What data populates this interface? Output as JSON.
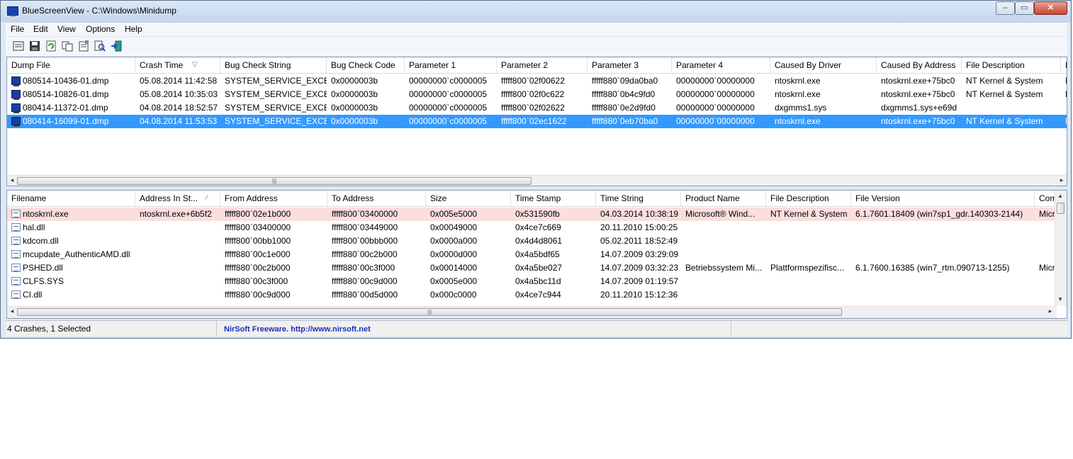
{
  "window": {
    "title": "BlueScreenView  -  C:\\Windows\\Minidump",
    "minimize": "–",
    "maximize": "▭",
    "close": "✕"
  },
  "menu": [
    "File",
    "Edit",
    "View",
    "Options",
    "Help"
  ],
  "toolbar": [
    "html-report-icon",
    "save-icon",
    "refresh-icon",
    "copy-icon",
    "properties-icon",
    "find-icon",
    "exit-icon"
  ],
  "top_table": {
    "headers": [
      "Dump File",
      "Crash Time",
      "Bug Check String",
      "Bug Check Code",
      "Parameter 1",
      "Parameter 2",
      "Parameter 3",
      "Parameter 4",
      "Caused By Driver",
      "Caused By Address",
      "File Description",
      "P"
    ],
    "sort_indicator": "▽",
    "rows": [
      [
        "080514-10436-01.dmp",
        "05.08.2014 11:42:58",
        "SYSTEM_SERVICE_EXCE...",
        "0x0000003b",
        "00000000`c0000005",
        "fffff800`02f00622",
        "fffff880`09da0ba0",
        "00000000`00000000",
        "ntoskrnl.exe",
        "ntoskrnl.exe+75bc0",
        "NT Kernel & System",
        "N"
      ],
      [
        "080514-10826-01.dmp",
        "05.08.2014 10:35:03",
        "SYSTEM_SERVICE_EXCE...",
        "0x0000003b",
        "00000000`c0000005",
        "fffff800`02f0c622",
        "fffff880`0b4c9fd0",
        "00000000`00000000",
        "ntoskrnl.exe",
        "ntoskrnl.exe+75bc0",
        "NT Kernel & System",
        "N"
      ],
      [
        "080414-11372-01.dmp",
        "04.08.2014 18:52:57",
        "SYSTEM_SERVICE_EXCE...",
        "0x0000003b",
        "00000000`c0000005",
        "fffff800`02f02622",
        "fffff880`0e2d9fd0",
        "00000000`00000000",
        "dxgmms1.sys",
        "dxgmms1.sys+e69d",
        "",
        ""
      ],
      [
        "080414-16099-01.dmp",
        "04.08.2014 11:53:53",
        "SYSTEM_SERVICE_EXCE...",
        "0x0000003b",
        "00000000`c0000005",
        "fffff800`02ec1622",
        "fffff880`0eb70ba0",
        "00000000`00000000",
        "ntoskrnl.exe",
        "ntoskrnl.exe+75bc0",
        "NT Kernel & System",
        "N"
      ]
    ],
    "selected_index": 3
  },
  "bottom_table": {
    "headers": [
      "Filename",
      "Address In St...",
      "From Address",
      "To Address",
      "Size",
      "Time Stamp",
      "Time String",
      "Product Name",
      "File Description",
      "File Version",
      "Com"
    ],
    "sort_indicator": "∕",
    "rows": [
      [
        "ntoskrnl.exe",
        "ntoskrnl.exe+6b5f2",
        "fffff800`02e1b000",
        "fffff800`03400000",
        "0x005e5000",
        "0x531590fb",
        "04.03.2014 10:38:19",
        "Microsoft® Wind...",
        "NT Kernel & System",
        "6.1.7601.18409 (win7sp1_gdr.140303-2144)",
        "Micr"
      ],
      [
        "hal.dll",
        "",
        "fffff800`03400000",
        "fffff800`03449000",
        "0x00049000",
        "0x4ce7c669",
        "20.11.2010 15:00:25",
        "",
        "",
        "",
        ""
      ],
      [
        "kdcom.dll",
        "",
        "fffff800`00bb1000",
        "fffff800`00bbb000",
        "0x0000a000",
        "0x4d4d8061",
        "05.02.2011 18:52:49",
        "",
        "",
        "",
        ""
      ],
      [
        "mcupdate_AuthenticAMD.dll",
        "",
        "fffff880`00c1e000",
        "fffff880`00c2b000",
        "0x0000d000",
        "0x4a5bdf65",
        "14.07.2009 03:29:09",
        "",
        "",
        "",
        ""
      ],
      [
        "PSHED.dll",
        "",
        "fffff880`00c2b000",
        "fffff880`00c3f000",
        "0x00014000",
        "0x4a5be027",
        "14.07.2009 03:32:23",
        "Betriebssystem Mi...",
        "Plattformspezifisc...",
        "6.1.7600.16385 (win7_rtm.090713-1255)",
        "Micr"
      ],
      [
        "CLFS.SYS",
        "",
        "fffff880`00c3f000",
        "fffff880`00c9d000",
        "0x0005e000",
        "0x4a5bc11d",
        "14.07.2009 01:19:57",
        "",
        "",
        "",
        ""
      ],
      [
        "CI.dll",
        "",
        "fffff880`00c9d000",
        "fffff880`00d5d000",
        "0x000c0000",
        "0x4ce7c944",
        "20.11.2010 15:12:36",
        "",
        "",
        "",
        ""
      ]
    ],
    "highlight_index": 0
  },
  "scrollbars": {
    "left_arrow": "◂",
    "right_arrow": "▸",
    "up_arrow": "▴",
    "down_arrow": "▾",
    "grip": "|||"
  },
  "status": {
    "summary": "4 Crashes, 1 Selected",
    "link": "NirSoft Freeware.  http://www.nirsoft.net"
  },
  "colors": {
    "selection": "#3399ff",
    "highlight_row": "#fbdede",
    "link": "#1a2fbf"
  }
}
